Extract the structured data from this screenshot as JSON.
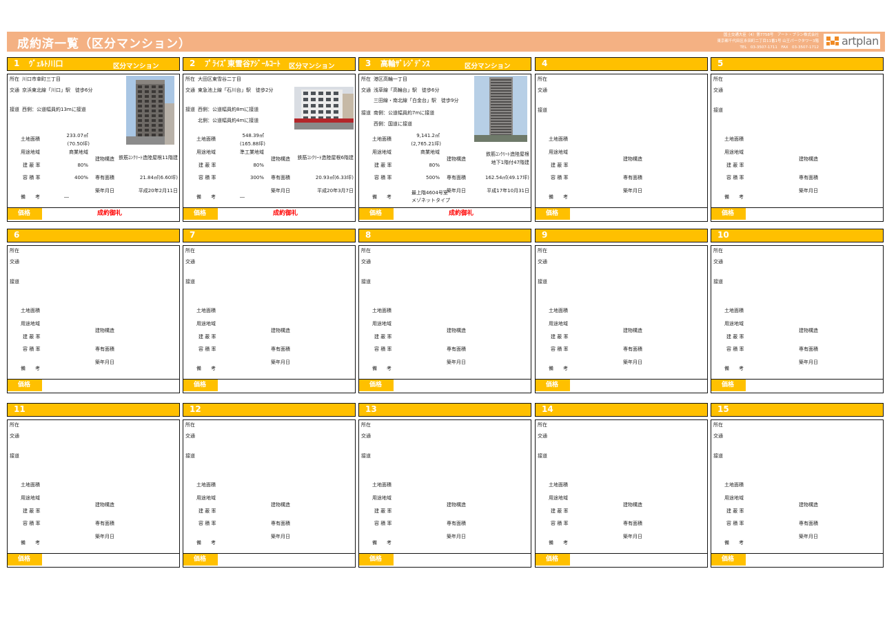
{
  "header": {
    "title": "成約済一覧（区分マンション）",
    "company_line1": "国土交通大臣（4）第7758号　アート・プラン株式会社",
    "company_line2": "東京都千代田区永田町二丁目11番1号 山王パークタワー3階",
    "company_line3": "TEL　03-3507-1711　FAX　03-3507-1712",
    "logo_text": "artplan"
  },
  "labels": {
    "shozai": "所在",
    "kotsu": "交通",
    "setsudo": "接道",
    "land_area": "土地面積",
    "youto": "用途地域",
    "kenpei": "建 蔽 率",
    "yoseki": "容 積 率",
    "biko": "備　　考",
    "structure": "建物構造",
    "senyu": "専有面積",
    "chiku": "築年月日",
    "price": "価格"
  },
  "cards": [
    {
      "num": "1",
      "name": "ｳﾞｪﾙﾄ川口",
      "type": "区分マンション",
      "shozai": "川口市幸町三丁目",
      "kotsu": [
        "京浜東北線「川口」駅　徒歩6分"
      ],
      "setsudo": [
        "西側：公道幅員約13mに接道"
      ],
      "land_area": "233.07㎡",
      "land_tsubo": "(70.50坪)",
      "youto": "商業地域",
      "kenpei": "80%",
      "yoseki": "400%",
      "biko": [
        "―"
      ],
      "structure": [
        "鉄筋ｺﾝｸﾘｰﾄ造陸屋根11階建"
      ],
      "senyu": "21.84㎡(6.60坪)",
      "chiku": "平成20年2月11日",
      "price": "成約御礼",
      "photo": "tower-photo"
    },
    {
      "num": "2",
      "name": "ﾌﾟﾗｲｽﾞ東雪谷ｱｼﾞｰﾙｺｰﾄ",
      "type": "区分マンション",
      "shozai": "大田区東雪谷二丁目",
      "kotsu": [
        "東急池上線「石川台」駅　徒歩2分"
      ],
      "setsudo": [
        "西側：公道幅員約8mに接道",
        "北側：公道幅員約4mに接道"
      ],
      "land_area": "548.39㎡",
      "land_tsubo": "(165.88坪)",
      "youto": "準工業地域",
      "kenpei": "80%",
      "yoseki": "300%",
      "biko": [
        "―"
      ],
      "structure": [
        "鉄筋ｺﾝｸﾘｰﾄ造陸屋根6階建"
      ],
      "senyu": "20.93㎡(6.33坪)",
      "chiku": "平成20年3月7日",
      "price": "成約御礼",
      "photo": "street-photo"
    },
    {
      "num": "3",
      "name": "高輪ｻﾞﾚｼﾞﾃﾞﾝｽ",
      "type": "区分マンション",
      "shozai": "港区高輪一丁目",
      "kotsu": [
        "浅草線「高輪台」駅　徒歩6分",
        "三田線・南北線「白金台」駅　徒歩9分"
      ],
      "setsudo": [
        "南側：公道幅員約7mに接道",
        "西側：国道に接道"
      ],
      "land_area": "9,141.2㎡",
      "land_tsubo": "(2,765.21坪)",
      "youto": "商業地域",
      "kenpei": "80%",
      "yoseki": "500%",
      "biko": [
        "最上階4604号室",
        "メゾネットタイプ"
      ],
      "structure": [
        "鉄筋ｺﾝｸﾘｰﾄ造陸屋根",
        "地下1階付47階建"
      ],
      "senyu": "162.54㎡(49.17坪)",
      "chiku": "平成17年10月31日",
      "price": "成約御礼",
      "photo": "highrise-photo"
    },
    {
      "num": "4"
    },
    {
      "num": "5"
    },
    {
      "num": "6"
    },
    {
      "num": "7"
    },
    {
      "num": "8"
    },
    {
      "num": "9"
    },
    {
      "num": "10"
    },
    {
      "num": "11"
    },
    {
      "num": "12"
    },
    {
      "num": "13"
    },
    {
      "num": "14"
    },
    {
      "num": "15"
    }
  ]
}
